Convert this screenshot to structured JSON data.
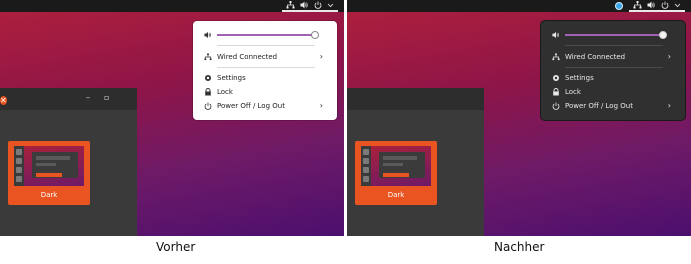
{
  "panels": [
    {
      "caption": "Vorher",
      "window": {
        "min_glyph": "–",
        "max_glyph": "▫",
        "close_glyph": "✕"
      },
      "theme_card": {
        "label": "Dark"
      },
      "menu": {
        "volume_level": 1.0,
        "wired": "Wired Connected",
        "settings": "Settings",
        "lock": "Lock",
        "power": "Power Off / Log Out"
      }
    },
    {
      "caption": "Nachher",
      "window": {
        "min_glyph": "",
        "max_glyph": "",
        "close_glyph": ""
      },
      "theme_card": {
        "label": "Dark"
      },
      "menu": {
        "volume_level": 1.0,
        "wired": "Wired Connected",
        "settings": "Settings",
        "lock": "Lock",
        "power": "Power Off / Log Out"
      }
    }
  ],
  "icons": {
    "tray": [
      "network-icon",
      "volume-icon",
      "power-icon",
      "chevron-down-icon"
    ],
    "extra_tray_right": "chromium-icon"
  },
  "colors": {
    "ubuntu_orange": "#e95420",
    "slider_purple": "#a063b4",
    "dark_menu_bg": "#303030",
    "light_menu_bg": "#ffffff"
  }
}
